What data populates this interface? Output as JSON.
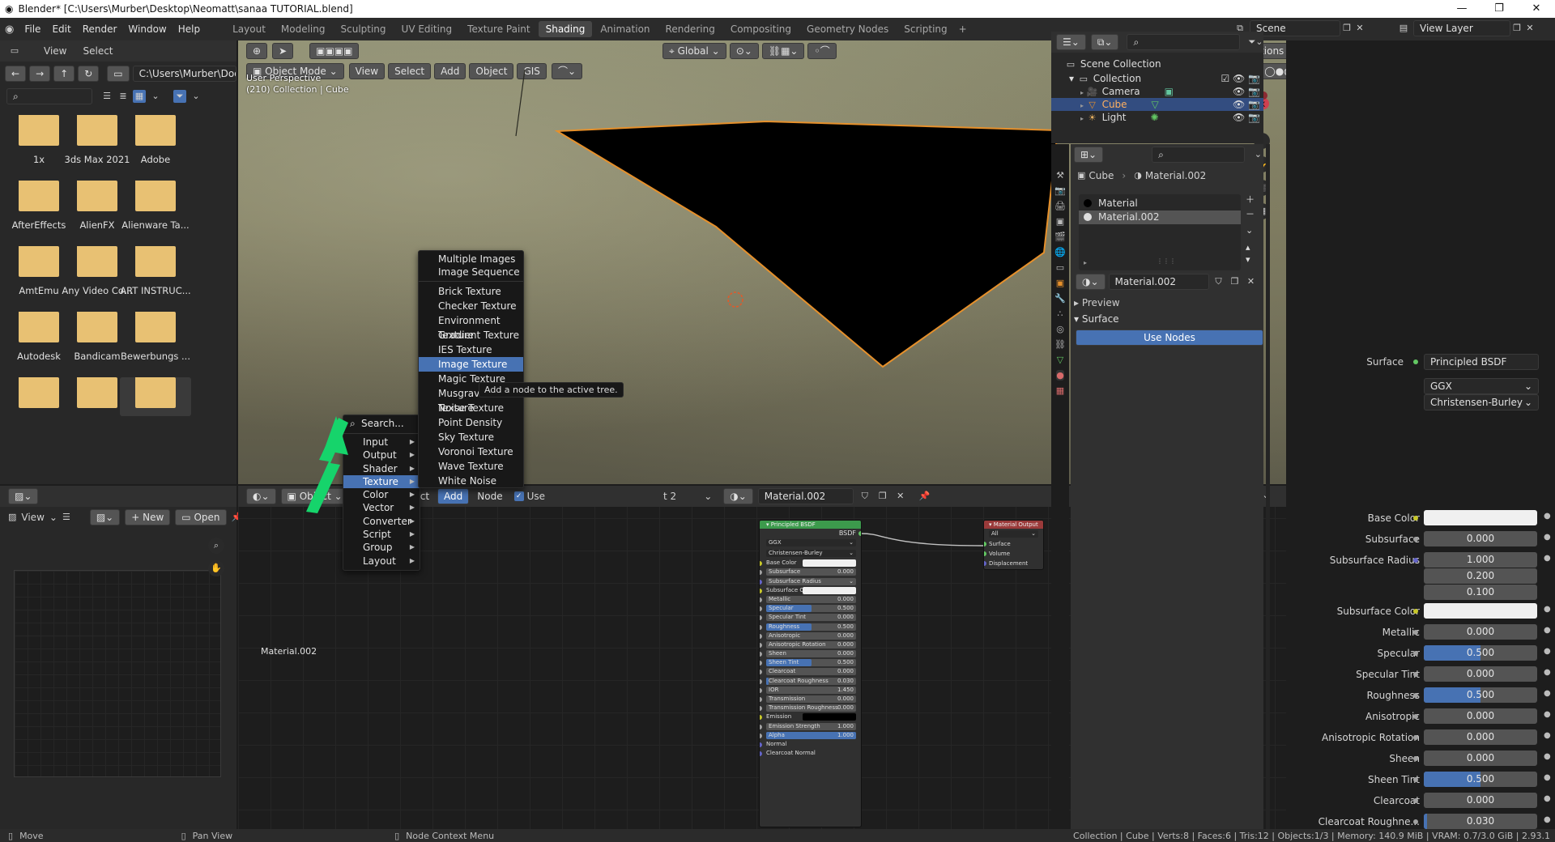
{
  "window": {
    "title": "Blender* [C:\\Users\\Murber\\Desktop\\Neomatt\\sanaa TUTORIAL.blend]"
  },
  "menubar": {
    "items": [
      "File",
      "Edit",
      "Render",
      "Window",
      "Help"
    ],
    "workspaces": [
      "Layout",
      "Modeling",
      "Sculpting",
      "UV Editing",
      "Texture Paint",
      "Shading",
      "Animation",
      "Rendering",
      "Compositing",
      "Geometry Nodes",
      "Scripting"
    ],
    "active_workspace": "Shading",
    "scene": "Scene",
    "view_layer": "View Layer"
  },
  "file_browser": {
    "menu_view": "View",
    "menu_select": "Select",
    "path": "C:\\Users\\Murber\\Docu...",
    "folders": [
      "1x",
      "3ds Max 2021",
      "Adobe",
      "AfterEffects",
      "AlienFX",
      "Alienware Ta...",
      "AmtEmu",
      "Any Video Co...",
      "ART INSTRUC...",
      "Autodesk",
      "Bandicam",
      "Bewerbungs ..."
    ]
  },
  "viewport": {
    "mode": "Object Mode",
    "menus": [
      "View",
      "Select",
      "Add",
      "Object",
      "GIS"
    ],
    "orientation": "Global",
    "options": "Options",
    "overlay_line1": "User Perspective",
    "overlay_line2": "(210) Collection | Cube"
  },
  "image_editor": {
    "view": "View",
    "new_label": "New",
    "open_label": "Open"
  },
  "node_editor": {
    "type": "Object",
    "menus": [
      "View",
      "Select",
      "Add",
      "Node"
    ],
    "use_nodes": "Use",
    "slot_partial": "t 2",
    "material": "Material.002",
    "footer_material": "Material.002"
  },
  "add_menu": {
    "search": "Search...",
    "items": [
      "Input",
      "Output",
      "Shader",
      "Texture",
      "Color",
      "Vector",
      "Converter",
      "Script",
      "Group",
      "Layout"
    ],
    "highlight": "Texture"
  },
  "texture_submenu": {
    "items_group1": [
      "Multiple Images",
      "Image Sequence"
    ],
    "items_group2": [
      "Brick Texture",
      "Checker Texture",
      "Environment Texture",
      "Gradient Texture",
      "IES Texture",
      "Image Texture",
      "Magic Texture",
      "Musgrave Texture",
      "Noise Texture",
      "Point Density",
      "Sky Texture",
      "Voronoi Texture",
      "Wave Texture",
      "White Noise"
    ],
    "highlight": "Image Texture",
    "tooltip": "Add a node to the active tree."
  },
  "bsdf_node": {
    "title": "Principled BSDF",
    "output": "BSDF",
    "dist": "GGX",
    "sss": "Christensen-Burley",
    "rows": [
      {
        "label": "Base Color",
        "type": "color",
        "sock": "#c7c729"
      },
      {
        "label": "Subsurface",
        "value": "0.000",
        "fill": 0,
        "sock": "#a1a1a1"
      },
      {
        "label": "Subsurface Radius",
        "type": "dropdown",
        "sock": "#6363c7"
      },
      {
        "label": "Subsurface C...",
        "type": "color",
        "sock": "#c7c729"
      },
      {
        "label": "Metallic",
        "value": "0.000",
        "fill": 0,
        "sock": "#a1a1a1"
      },
      {
        "label": "Specular",
        "value": "0.500",
        "fill": 0.5,
        "sock": "#a1a1a1"
      },
      {
        "label": "Specular Tint",
        "value": "0.000",
        "fill": 0,
        "sock": "#a1a1a1"
      },
      {
        "label": "Roughness",
        "value": "0.500",
        "fill": 0.5,
        "sock": "#a1a1a1"
      },
      {
        "label": "Anisotropic",
        "value": "0.000",
        "fill": 0,
        "sock": "#a1a1a1"
      },
      {
        "label": "Anisotropic Rotation",
        "value": "0.000",
        "fill": 0,
        "sock": "#a1a1a1"
      },
      {
        "label": "Sheen",
        "value": "0.000",
        "fill": 0,
        "sock": "#a1a1a1"
      },
      {
        "label": "Sheen Tint",
        "value": "0.500",
        "fill": 0.5,
        "sock": "#a1a1a1"
      },
      {
        "label": "Clearcoat",
        "value": "0.000",
        "fill": 0,
        "sock": "#a1a1a1"
      },
      {
        "label": "Clearcoat Roughness",
        "value": "0.030",
        "fill": 0.03,
        "sock": "#a1a1a1"
      },
      {
        "label": "IOR",
        "value": "1.450",
        "fill": 0,
        "sock": "#a1a1a1"
      },
      {
        "label": "Transmission",
        "value": "0.000",
        "fill": 0,
        "sock": "#a1a1a1"
      },
      {
        "label": "Transmission Roughness",
        "value": "0.000",
        "fill": 0,
        "sock": "#a1a1a1"
      },
      {
        "label": "Emission",
        "type": "black",
        "sock": "#c7c729"
      },
      {
        "label": "Emission Strength",
        "value": "1.000",
        "fill": 0,
        "sock": "#a1a1a1"
      },
      {
        "label": "Alpha",
        "value": "1.000",
        "fill": 1,
        "sock": "#a1a1a1"
      },
      {
        "label": "Normal",
        "type": "plain",
        "sock": "#6363c7"
      },
      {
        "label": "Clearcoat Normal",
        "type": "plain",
        "sock": "#6363c7"
      }
    ]
  },
  "output_node": {
    "title": "Material Output",
    "target": "All",
    "inputs": [
      "Surface",
      "Volume",
      "Displacement"
    ]
  },
  "outliner": {
    "root": "Scene Collection",
    "collection": "Collection",
    "items": [
      "Camera",
      "Cube",
      "Light"
    ],
    "selected": "Cube"
  },
  "properties": {
    "object": "Cube",
    "material_crumb": "Material.002",
    "slots": [
      "Material",
      "Material.002"
    ],
    "material_name": "Material.002",
    "preview": "Preview",
    "surface_panel": "Surface",
    "use_nodes": "Use Nodes",
    "surface_label": "Surface",
    "surface_value": "Principled BSDF",
    "dist": "GGX",
    "sss": "Christensen-Burley",
    "rows": [
      {
        "label": "Base Color",
        "type": "color"
      },
      {
        "label": "Subsurface",
        "value": "0.000",
        "fill": 0
      },
      {
        "label": "Subsurface Radius",
        "value": "1.000",
        "fill": 0,
        "extra": [
          "0.200",
          "0.100"
        ]
      },
      {
        "label": "Subsurface Color",
        "type": "color"
      },
      {
        "label": "Metallic",
        "value": "0.000",
        "fill": 0
      },
      {
        "label": "Specular",
        "value": "0.500",
        "fill": 0.5
      },
      {
        "label": "Specular Tint",
        "value": "0.000",
        "fill": 0
      },
      {
        "label": "Roughness",
        "value": "0.500",
        "fill": 0.5
      },
      {
        "label": "Anisotropic",
        "value": "0.000",
        "fill": 0
      },
      {
        "label": "Anisotropic Rotation",
        "value": "0.000",
        "fill": 0
      },
      {
        "label": "Sheen",
        "value": "0.000",
        "fill": 0
      },
      {
        "label": "Sheen Tint",
        "value": "0.500",
        "fill": 0.5
      },
      {
        "label": "Clearcoat",
        "value": "0.000",
        "fill": 0
      },
      {
        "label": "Clearcoat Roughne...",
        "value": "0.030",
        "fill": 0.03
      }
    ]
  },
  "statusbar": {
    "move": "Move",
    "pan": "Pan View",
    "context": "Node Context Menu",
    "stats": "Collection | Cube | Verts:8 | Faces:6 | Tris:12 | Objects:1/3 | Memory: 140.9 MiB | VRAM: 0.7/3.0 GiB | 2.93.1"
  },
  "colors": {
    "accent": "#4772b3",
    "selection": "#e6902b",
    "arrow": "#16d46b"
  }
}
